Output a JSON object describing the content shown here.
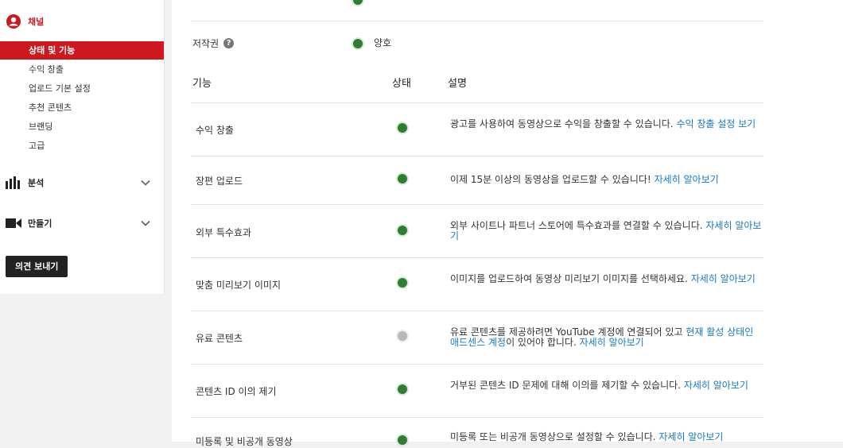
{
  "sidebar": {
    "channel_label": "채널",
    "items": [
      {
        "label": "상태 및 기능",
        "active": true
      },
      {
        "label": "수익 창출",
        "active": false
      },
      {
        "label": "업로드 기본 설정",
        "active": false
      },
      {
        "label": "추천 콘텐츠",
        "active": false
      },
      {
        "label": "브랜딩",
        "active": false
      },
      {
        "label": "고급",
        "active": false
      }
    ],
    "analytics_label": "분석",
    "create_label": "만들기",
    "feedback_button": "의견 보내기"
  },
  "copyright": {
    "label": "저작권",
    "status": "양호"
  },
  "table": {
    "headers": {
      "feature": "기능",
      "status": "상태",
      "description": "설명"
    },
    "rows": [
      {
        "name": "수익 창출",
        "status": "green",
        "desc": "광고를 사용하여 동영상으로 수익을 창출할 수 있습니다.",
        "link": "수익 창출 설정 보기"
      },
      {
        "name": "장편 업로드",
        "status": "green",
        "desc": "이제 15분 이상의 동영상을 업로드할 수 있습니다!",
        "link": "자세히 알아보기"
      },
      {
        "name": "외부 특수효과",
        "status": "green",
        "desc": "외부 사이트나 파트너 스토어에 특수효과를 연결할 수 있습니다.",
        "link": "자세히 알아보기"
      },
      {
        "name": "맞춤 미리보기 이미지",
        "status": "green",
        "desc": "이미지를 업로드하여 동영상 미리보기 이미지를 선택하세요.",
        "link": "자세히 알아보기"
      },
      {
        "name": "유료 콘텐츠",
        "status": "grey",
        "desc_a": "유료 콘텐츠를 제공하려면 YouTube 계정에 연결되어 있고",
        "link_a": "현재 활성 상태인 애드센스 계정",
        "desc_b": "이 있어야 합니다.",
        "link": "자세히 알아보기"
      },
      {
        "name": "콘텐츠 ID 이의 제기",
        "status": "green",
        "desc": "거부된 콘텐츠 ID 문제에 대해 이의를 제기할 수 있습니다.",
        "link": "자세히 알아보기"
      },
      {
        "name": "미등록 및 비공개 동영상",
        "status": "green",
        "desc": "미등록 또는 비공개 동영상으로 설정할 수 있습니다.",
        "link": "자세히 알아보기"
      }
    ]
  },
  "colors": {
    "accent": "#cc181e",
    "link": "#167ac6",
    "status_good": "#2f7d32",
    "status_off": "#b9b9b9"
  }
}
